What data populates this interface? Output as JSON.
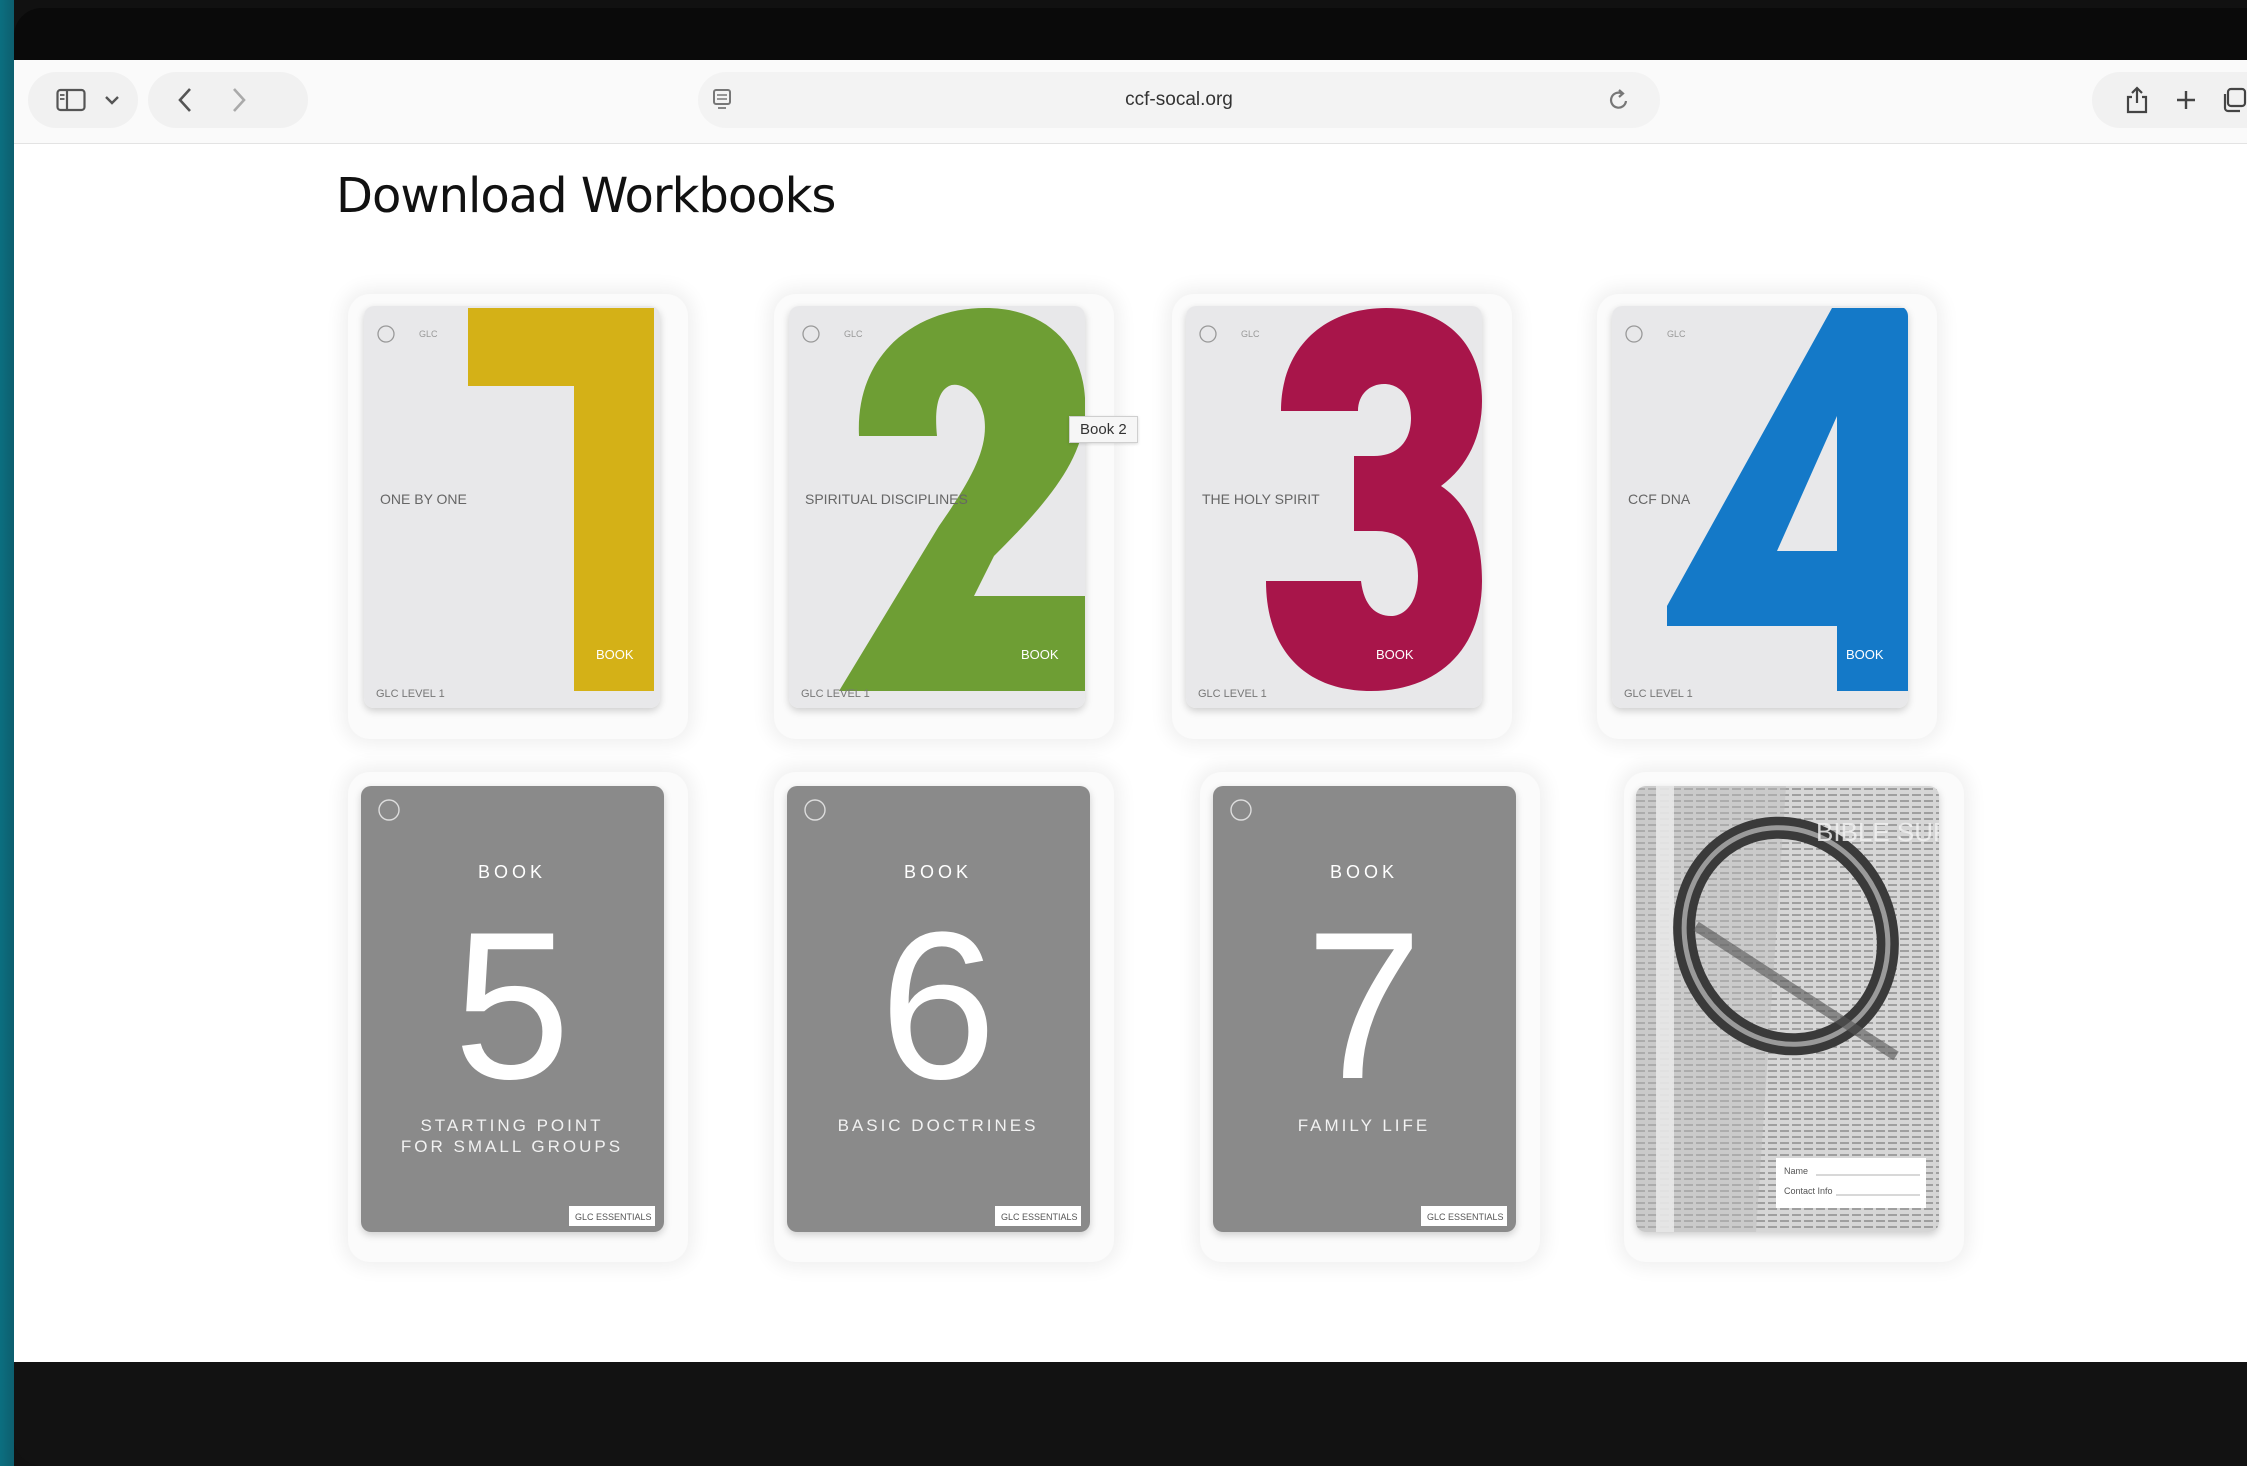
{
  "browser": {
    "url": "ccf-socal.org"
  },
  "page": {
    "title": "Download Workbooks",
    "tooltip": "Book 2"
  },
  "books": [
    {
      "number": "1",
      "subtitle": "ONE BY ONE",
      "tag": "BOOK",
      "footer": "GLC LEVEL 1",
      "color": "#d4b117"
    },
    {
      "number": "2",
      "subtitle": "SPIRITUAL DISCIPLINES",
      "tag": "BOOK",
      "footer": "GLC LEVEL 1",
      "color": "#6e9e34"
    },
    {
      "number": "3",
      "subtitle": "THE HOLY SPIRIT",
      "tag": "BOOK",
      "footer": "GLC LEVEL 1",
      "color": "#a8154a"
    },
    {
      "number": "4",
      "subtitle": "CCF DNA",
      "tag": "BOOK",
      "footer": "GLC LEVEL 1",
      "color": "#1479c8"
    },
    {
      "number": "5",
      "heading": "BOOK",
      "subtitle_lines": [
        "STARTING POINT",
        "FOR SMALL GROUPS"
      ],
      "footer": "GLC ESSENTIALS"
    },
    {
      "number": "6",
      "heading": "BOOK",
      "subtitle_lines": [
        "BASIC DOCTRINES"
      ],
      "footer": "GLC ESSENTIALS"
    },
    {
      "number": "7",
      "heading": "BOOK",
      "subtitle_lines": [
        "FAMILY LIFE"
      ],
      "footer": "GLC ESSENTIALS"
    },
    {
      "cover_title": "BIBLE SURVEY",
      "form_lines": [
        "Name",
        "Contact Info"
      ]
    }
  ],
  "colors": {
    "gray_cover": "#8a8a8a",
    "light_cover": "#e8e8ea"
  }
}
